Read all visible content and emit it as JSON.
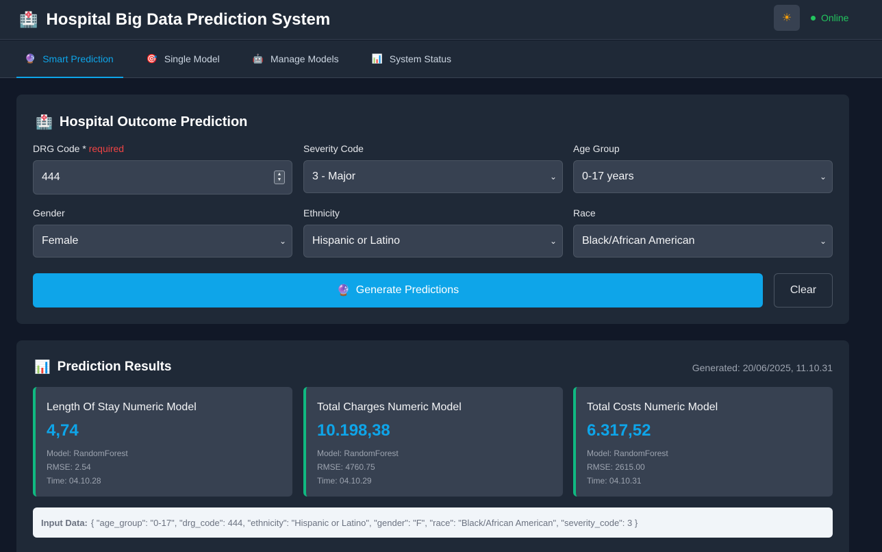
{
  "header": {
    "logo_icon": "🏥",
    "title": "Hospital Big Data Prediction System",
    "theme_icon": "☀",
    "status": "Online"
  },
  "tabs": [
    {
      "icon": "🔮",
      "label": "Smart Prediction",
      "active": true
    },
    {
      "icon": "🎯",
      "label": "Single Model",
      "active": false
    },
    {
      "icon": "🤖",
      "label": "Manage Models",
      "active": false
    },
    {
      "icon": "📊",
      "label": "System Status",
      "active": false
    }
  ],
  "form": {
    "icon": "🏥",
    "title": "Hospital Outcome Prediction",
    "drg_label": "DRG Code *",
    "drg_required": "required",
    "drg_value": "444",
    "severity_label": "Severity Code",
    "severity_value": "3 - Major",
    "age_label": "Age Group",
    "age_value": "0-17 years",
    "gender_label": "Gender",
    "gender_value": "Female",
    "ethnicity_label": "Ethnicity",
    "ethnicity_value": "Hispanic or Latino",
    "race_label": "Race",
    "race_value": "Black/African American",
    "generate_icon": "🔮",
    "generate_label": "Generate Predictions",
    "clear_label": "Clear"
  },
  "results": {
    "icon": "📊",
    "title": "Prediction Results",
    "generated": "Generated: 20/06/2025, 11.10.31",
    "cards": [
      {
        "title": "Length Of Stay Numeric Model",
        "value": "4,74",
        "model": "Model: RandomForest",
        "rmse": "RMSE: 2.54",
        "time": "Time: 04.10.28"
      },
      {
        "title": "Total Charges Numeric Model",
        "value": "10.198,38",
        "model": "Model: RandomForest",
        "rmse": "RMSE: 4760.75",
        "time": "Time: 04.10.29"
      },
      {
        "title": "Total Costs Numeric Model",
        "value": "6.317,52",
        "model": "Model: RandomForest",
        "rmse": "RMSE: 2615.00",
        "time": "Time: 04.10.31"
      }
    ],
    "input_label": "Input Data:",
    "input_value": "{ \"age_group\": \"0-17\", \"drg_code\": 444, \"ethnicity\": \"Hispanic or Latino\", \"gender\": \"F\", \"race\": \"Black/African American\", \"severity_code\": 3 }"
  },
  "colors": {
    "accent": "#0ea5e9",
    "online": "#22c55e",
    "result_border": "#10b981",
    "required": "#ef4444"
  }
}
